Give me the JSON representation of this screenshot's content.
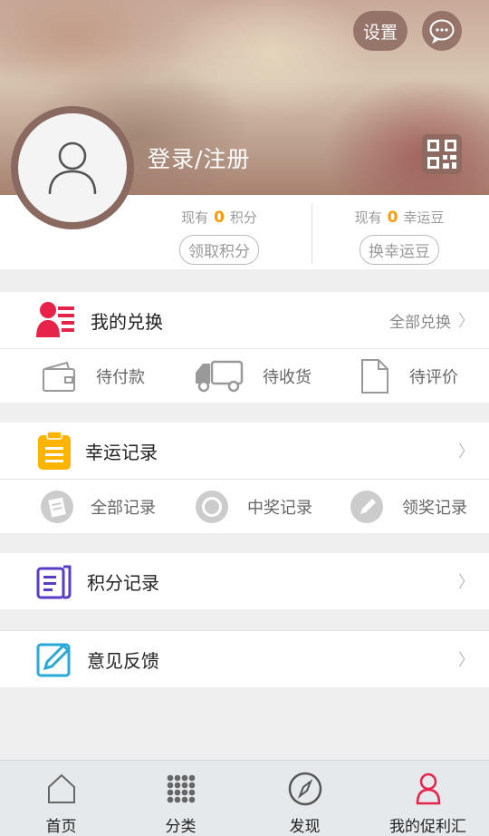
{
  "header": {
    "settings_label": "设置",
    "login_label": "登录/注册"
  },
  "stats": {
    "points": {
      "prefix": "现有",
      "value": "0",
      "unit": "积分",
      "button": "领取积分"
    },
    "beans": {
      "prefix": "现有",
      "value": "0",
      "unit": "幸运豆",
      "button": "换幸运豆"
    }
  },
  "exchange": {
    "title": "我的兑换",
    "all_label": "全部兑换",
    "items": [
      {
        "label": "待付款",
        "icon": "wallet-icon"
      },
      {
        "label": "待收货",
        "icon": "truck-icon"
      },
      {
        "label": "待评价",
        "icon": "document-icon"
      }
    ]
  },
  "lucky": {
    "title": "幸运记录",
    "items": [
      {
        "label": "全部记录",
        "icon": "record-list-icon"
      },
      {
        "label": "中奖记录",
        "icon": "badge-icon"
      },
      {
        "label": "领奖记录",
        "icon": "pen-check-icon"
      }
    ]
  },
  "points_record": {
    "title": "积分记录"
  },
  "feedback": {
    "title": "意见反馈"
  },
  "tabbar": {
    "tabs": [
      {
        "label": "首页",
        "icon": "home-icon"
      },
      {
        "label": "分类",
        "icon": "grid-icon"
      },
      {
        "label": "发现",
        "icon": "compass-icon"
      },
      {
        "label": "我的促利汇",
        "icon": "user-icon"
      }
    ],
    "active_index": 3
  },
  "colors": {
    "accent_orange": "#ff9a00",
    "exchange_icon": "#e8234a",
    "lucky_icon": "#ffb400",
    "points_icon": "#5b3cc4",
    "feedback_icon": "#2aa8d8",
    "active_tab": "#e8234a"
  }
}
